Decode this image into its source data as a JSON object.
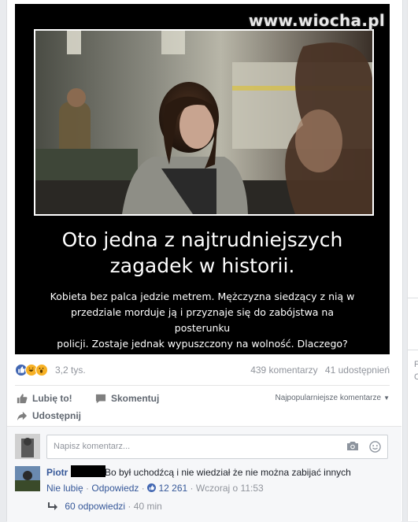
{
  "watermark": "www.wiocha.pl",
  "post": {
    "headline_line1": "Oto jedna z najtrudniejszych",
    "headline_line2": "zagadek w historii.",
    "desc_line1": "Kobieta bez palca jedzie metrem. Mężczyzna siedzący z nią w",
    "desc_line2": "przedziale morduje ją i przyznaje się do zabójstwa na posterunku",
    "desc_line3": "policji. Zostaje jednak wypuszczony na wolność. Dlaczego?"
  },
  "stats": {
    "reactions_count": "3,2 tys.",
    "comments_count": "439 komentarzy",
    "shares_count": "41 udostępnień"
  },
  "actions": {
    "like_label": "Lubię to!",
    "comment_label": "Skomentuj",
    "share_label": "Udostępnij",
    "sort_label": "Najpopularniejsze komentarze"
  },
  "composer": {
    "placeholder": "Napisz komentarz..."
  },
  "comment": {
    "author": "Piotr",
    "text": "Bo był uchodźcą i nie wiedział że nie można zabijać innych",
    "unlike_label": "Nie lubię",
    "reply_label": "Odpowiedz",
    "likes": "12 261",
    "time": "Wczoraj o 11:53",
    "replies_label": "60 odpowiedzi",
    "replies_time": "40 min"
  },
  "sidebar": {
    "frag1": "F",
    "frag2": "C"
  },
  "colors": {
    "link": "#365899",
    "muted": "#90949c",
    "like_blue": "#4267b2",
    "haha_yellow": "#f7b125"
  },
  "icons": [
    "like-reaction-icon",
    "haha-reaction-icon",
    "wow-reaction-icon",
    "thumbs-up-icon",
    "comment-icon",
    "share-arrow-icon",
    "camera-icon",
    "smiley-icon",
    "reply-arrow-icon",
    "caret-down-icon"
  ]
}
